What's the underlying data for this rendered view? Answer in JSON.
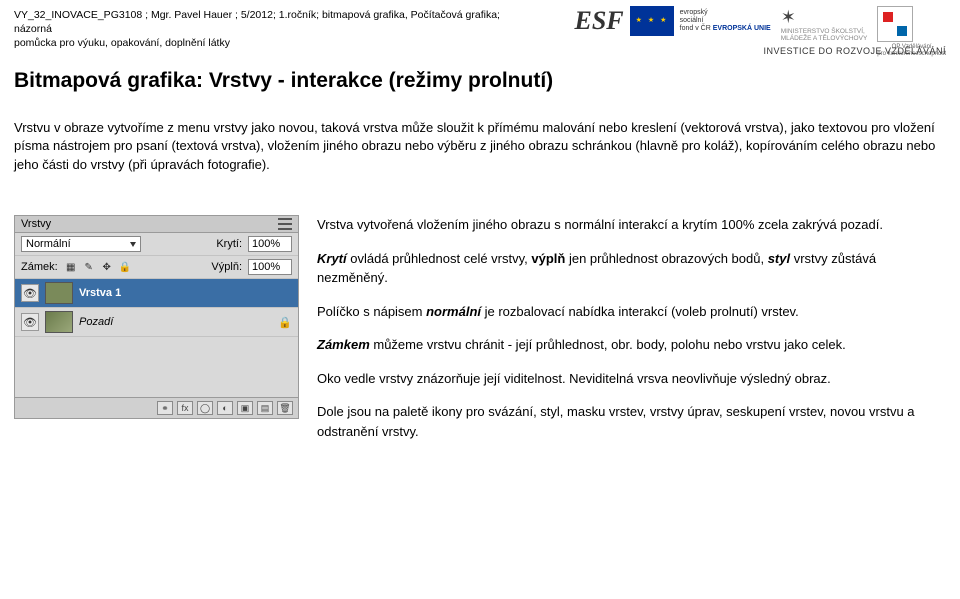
{
  "meta": {
    "line1": "VY_32_INOVACE_PG3108 ; Mgr. Pavel Hauer ; 5/2012; 1.ročník; bitmapová grafika, Počítačová grafika; názorná",
    "line2": "pomůcka pro výuku, opakování, doplnění látky"
  },
  "logos": {
    "esf_l1": "evropský",
    "esf_l2": "sociální",
    "esf_l3": "fond v ČR",
    "esf_l4": "EVROPSKÁ UNIE",
    "ms_l1": "MINISTERSTVO ŠKOLSTVÍ,",
    "ms_l2": "MLÁDEŽE A TĚLOVÝCHOVY",
    "op_l1": "OP Vzdělávání",
    "op_l2": "pro konkurenceschopnost",
    "invest": "INVESTICE DO ROZVOJE VZDĚLÁVÁNÍ"
  },
  "title": "Bitmapová grafika:  Vrstvy - interakce (režimy prolnutí)",
  "intro": "Vrstvu v obraze vytvoříme z menu vrstvy jako novou, taková vrstva může sloužit k přímému malování nebo kreslení (vektorová vrstva), jako textovou pro vložení písma nástrojem pro psaní (textová vrstva), vložením jiného obrazu nebo výběru z jiného obrazu schránkou (hlavně pro koláž), kopírováním celého obrazu nebo jeho části do vrstvy (při úpravách fotografie).",
  "panel": {
    "tab": "Vrstvy",
    "mode_label": "",
    "mode_value": "Normální",
    "opacity_label": "Krytí:",
    "opacity_value": "100%",
    "lock_label": "Zámek:",
    "fill_label": "Výplň:",
    "fill_value": "100%",
    "layer1": "Vrstva 1",
    "layer_bg": "Pozadí"
  },
  "notes": {
    "p1": "Vrstva vytvořená vložením jiného obrazu s normální interakcí a krytím 100% zcela zakrývá pozadí.",
    "p2a": "Krytí",
    "p2b": " ovládá průhlednost celé vrstvy, ",
    "p2c": "výplň",
    "p2d": " jen průhlednost obrazových bodů, ",
    "p2e": "styl",
    "p2f": " vrstvy zůstává nezměněný.",
    "p3a": "Políčko s nápisem ",
    "p3b": "normální",
    "p3c": " je rozbalovací nabídka interakcí (voleb prolnutí) vrstev.",
    "p4a": "Zámkem",
    "p4b": " můžeme vrstvu chránit - její průhlednost, obr. body, polohu nebo vrstvu jako celek.",
    "p5": "Oko vedle vrstvy znázorňuje její viditelnost. Neviditelná vrsva neovlivňuje výsledný obraz.",
    "p6": "Dole jsou na paletě ikony pro svázání, styl, masku vrstev, vrstvy úprav, seskupení vrstev, novou vrstvu a odstranění vrstvy."
  }
}
